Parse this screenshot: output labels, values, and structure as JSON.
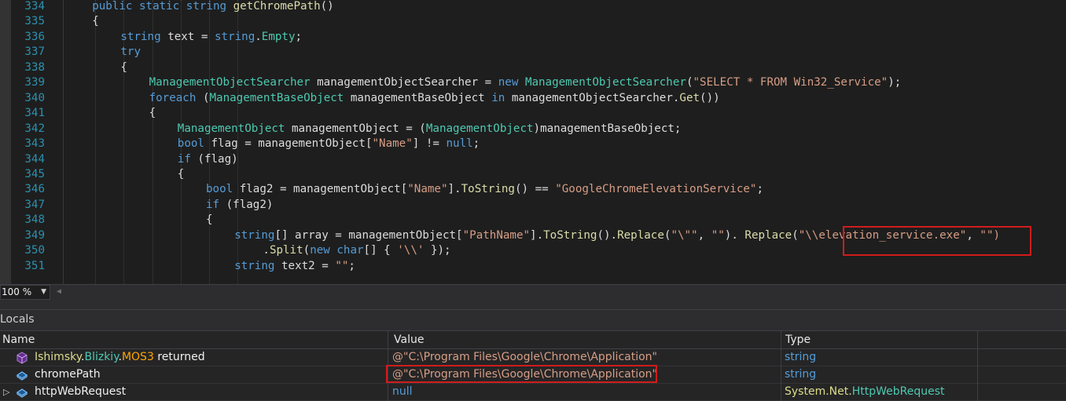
{
  "editor": {
    "lines": [
      {
        "n": "334",
        "indent": 4,
        "tokens": [
          [
            "kw",
            "public "
          ],
          [
            "kw",
            "static "
          ],
          [
            "kw",
            "string "
          ],
          [
            "meth",
            "getChromePath"
          ],
          [
            "plain",
            "()"
          ]
        ]
      },
      {
        "n": "335",
        "indent": 4,
        "tokens": [
          [
            "plain",
            "{"
          ]
        ]
      },
      {
        "n": "336",
        "indent": 8,
        "tokens": [
          [
            "kw",
            "string "
          ],
          [
            "plain",
            "text = "
          ],
          [
            "kw",
            "string"
          ],
          [
            "plain",
            "."
          ],
          [
            "type",
            "Empty"
          ],
          [
            "plain",
            ";"
          ]
        ]
      },
      {
        "n": "337",
        "indent": 8,
        "tokens": [
          [
            "kw",
            "try"
          ]
        ]
      },
      {
        "n": "338",
        "indent": 8,
        "tokens": [
          [
            "plain",
            "{"
          ]
        ]
      },
      {
        "n": "339",
        "indent": 12,
        "tokens": [
          [
            "type",
            "ManagementObjectSearcher "
          ],
          [
            "plain",
            "managementObjectSearcher = "
          ],
          [
            "kw",
            "new "
          ],
          [
            "type",
            "ManagementObjectSearcher"
          ],
          [
            "plain",
            "("
          ],
          [
            "str",
            "\"SELECT * FROM Win32_Service\""
          ],
          [
            "plain",
            ");"
          ]
        ]
      },
      {
        "n": "340",
        "indent": 12,
        "tokens": [
          [
            "kw",
            "foreach "
          ],
          [
            "plain",
            "("
          ],
          [
            "type",
            "ManagementBaseObject "
          ],
          [
            "plain",
            "managementBaseObject "
          ],
          [
            "kw",
            "in "
          ],
          [
            "plain",
            "managementObjectSearcher."
          ],
          [
            "meth",
            "Get"
          ],
          [
            "plain",
            "())"
          ]
        ]
      },
      {
        "n": "341",
        "indent": 12,
        "tokens": [
          [
            "plain",
            "{"
          ]
        ]
      },
      {
        "n": "342",
        "indent": 16,
        "tokens": [
          [
            "type",
            "ManagementObject "
          ],
          [
            "plain",
            "managementObject = ("
          ],
          [
            "type",
            "ManagementObject"
          ],
          [
            "plain",
            ")managementBaseObject;"
          ]
        ]
      },
      {
        "n": "343",
        "indent": 16,
        "tokens": [
          [
            "kw",
            "bool "
          ],
          [
            "plain",
            "flag = managementObject["
          ],
          [
            "str",
            "\"Name\""
          ],
          [
            "plain",
            "] != "
          ],
          [
            "kw",
            "null"
          ],
          [
            "plain",
            ";"
          ]
        ]
      },
      {
        "n": "344",
        "indent": 16,
        "tokens": [
          [
            "kw",
            "if "
          ],
          [
            "plain",
            "(flag)"
          ]
        ]
      },
      {
        "n": "345",
        "indent": 16,
        "tokens": [
          [
            "plain",
            "{"
          ]
        ]
      },
      {
        "n": "346",
        "indent": 20,
        "tokens": [
          [
            "kw",
            "bool "
          ],
          [
            "plain",
            "flag2 = managementObject["
          ],
          [
            "str",
            "\"Name\""
          ],
          [
            "plain",
            "]."
          ],
          [
            "meth",
            "ToString"
          ],
          [
            "plain",
            "() == "
          ],
          [
            "str",
            "\"GoogleChromeElevationService\""
          ],
          [
            "plain",
            ";"
          ]
        ]
      },
      {
        "n": "347",
        "indent": 20,
        "tokens": [
          [
            "kw",
            "if "
          ],
          [
            "plain",
            "(flag2)"
          ]
        ]
      },
      {
        "n": "348",
        "indent": 20,
        "tokens": [
          [
            "plain",
            "{"
          ]
        ]
      },
      {
        "n": "349",
        "indent": 24,
        "tokens": [
          [
            "kw",
            "string"
          ],
          [
            "plain",
            "[] array = managementObject["
          ],
          [
            "str",
            "\"PathName\""
          ],
          [
            "plain",
            "]."
          ],
          [
            "meth",
            "ToString"
          ],
          [
            "plain",
            "()."
          ],
          [
            "meth",
            "Replace"
          ],
          [
            "plain",
            "("
          ],
          [
            "str",
            "\"\\\"\""
          ],
          [
            "plain",
            ", "
          ],
          [
            "str",
            "\"\""
          ],
          [
            "plain",
            "). "
          ],
          [
            "meth",
            "Replace"
          ],
          [
            "plain",
            "("
          ],
          [
            "str",
            "\"\\\\elevation_service.exe\""
          ],
          [
            "plain",
            ", "
          ],
          [
            "str",
            "\"\")"
          ]
        ]
      },
      {
        "n": "350",
        "indent": 28,
        "tokens": [
          [
            "plain",
            "."
          ],
          [
            "meth",
            "Split"
          ],
          [
            "plain",
            "("
          ],
          [
            "kw",
            "new "
          ],
          [
            "kw",
            "char"
          ],
          [
            "plain",
            "[] { "
          ],
          [
            "str",
            "'\\\\'"
          ],
          [
            "plain",
            " });"
          ]
        ]
      },
      {
        "n": "351",
        "indent": 24,
        "tokens": [
          [
            "kw",
            "string "
          ],
          [
            "plain",
            "text2 = "
          ],
          [
            "str",
            "\"\""
          ],
          [
            "plain",
            ";"
          ]
        ]
      }
    ]
  },
  "zoom": {
    "label": "100 %"
  },
  "locals": {
    "title": "Locals",
    "columns": {
      "name": "Name",
      "value": "Value",
      "type": "Type"
    },
    "rows": [
      {
        "expander": "",
        "icon": "method-return-icon",
        "name_parts": [
          [
            "ns-y",
            "Ishimsky"
          ],
          [
            "ns-w",
            "."
          ],
          [
            "ns-c",
            "Blizkiy"
          ],
          [
            "ns-w",
            "."
          ],
          [
            "ns-o",
            "MOS3"
          ],
          [
            "ns-w",
            " returned"
          ]
        ],
        "value": "@\"C:\\Program Files\\Google\\Chrome\\Application\"",
        "type_parts": [
          [
            "plain",
            "string"
          ]
        ]
      },
      {
        "expander": "",
        "icon": "field-icon",
        "name_parts": [
          [
            "ns-w",
            "chromePath"
          ]
        ],
        "value": "@\"C:\\Program Files\\Google\\Chrome\\Application\"",
        "type_parts": [
          [
            "plain",
            "string"
          ]
        ]
      },
      {
        "expander": "▷",
        "icon": "field-icon",
        "name_parts": [
          [
            "ns-w",
            "httpWebRequest"
          ]
        ],
        "value": "null",
        "type_parts": [
          [
            "type-ns",
            "System.Net."
          ],
          [
            "type-cls",
            "HttpWebRequest"
          ]
        ]
      }
    ]
  },
  "colors": {
    "highlight": "#d01c1c",
    "keyword": "#569cd6",
    "type": "#4ec9b0",
    "string": "#d69d85",
    "method": "#dcdcaa",
    "line_number": "#2b91af"
  }
}
